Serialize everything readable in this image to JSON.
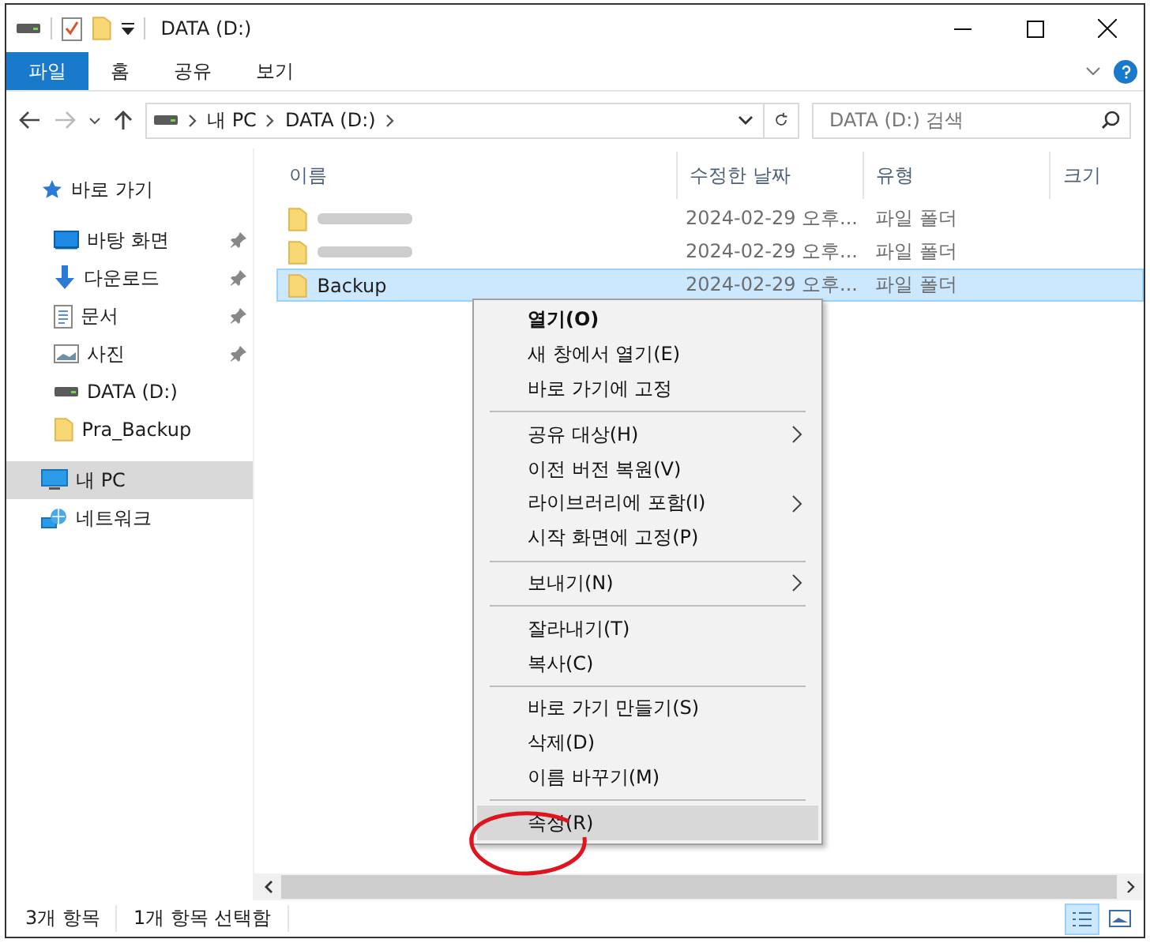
{
  "window": {
    "title": "DATA (D:)"
  },
  "ribbon_tabs": [
    {
      "label": "파일",
      "selected": true
    },
    {
      "label": "홈",
      "selected": false
    },
    {
      "label": "공유",
      "selected": false
    },
    {
      "label": "보기",
      "selected": false
    }
  ],
  "address": {
    "crumbs": [
      "내 PC",
      "DATA (D:)"
    ]
  },
  "search": {
    "placeholder": "DATA (D:) 검색"
  },
  "sidebar": {
    "items": [
      {
        "label": "바로 가기",
        "kind": "quick",
        "selected": false,
        "pinned": false,
        "children": [
          {
            "label": "바탕 화면",
            "kind": "desktop",
            "selected": false,
            "pinned": true
          },
          {
            "label": "다운로드",
            "kind": "download",
            "selected": false,
            "pinned": true
          },
          {
            "label": "문서",
            "kind": "document",
            "selected": false,
            "pinned": true
          },
          {
            "label": "사진",
            "kind": "pictures",
            "selected": false,
            "pinned": true
          },
          {
            "label": "DATA (D:)",
            "kind": "drive",
            "selected": false,
            "pinned": false
          },
          {
            "label": "Pra_Backup",
            "kind": "folder",
            "selected": false,
            "pinned": false
          }
        ]
      },
      {
        "label": "내 PC",
        "kind": "pc",
        "selected": true,
        "pinned": false
      },
      {
        "label": "네트워크",
        "kind": "network",
        "selected": false,
        "pinned": false
      }
    ]
  },
  "table": {
    "columns": [
      "이름",
      "수정한 날짜",
      "유형",
      "크기"
    ],
    "rows": [
      {
        "kind": "blurred",
        "modified": "2024-02-29 오후...",
        "type": "파일 폴더",
        "selected": false
      },
      {
        "kind": "blurred",
        "modified": "2024-02-29 오후...",
        "type": "파일 폴더",
        "selected": false
      },
      {
        "kind": "named",
        "name": "Backup",
        "modified": "2024-02-29 오후...",
        "type": "파일 폴더",
        "selected": true
      }
    ]
  },
  "context_menu": {
    "items": [
      {
        "kind": "item",
        "label": "열기(O)",
        "default": true,
        "submenu": false,
        "selected": false
      },
      {
        "kind": "item",
        "label": "새 창에서 열기(E)",
        "default": false,
        "submenu": false,
        "selected": false
      },
      {
        "kind": "item",
        "label": "바로 가기에 고정",
        "default": false,
        "submenu": false,
        "selected": false
      },
      {
        "kind": "separator"
      },
      {
        "kind": "item",
        "label": "공유 대상(H)",
        "default": false,
        "submenu": true,
        "selected": false
      },
      {
        "kind": "item",
        "label": "이전 버전 복원(V)",
        "default": false,
        "submenu": false,
        "selected": false
      },
      {
        "kind": "item",
        "label": "라이브러리에 포함(I)",
        "default": false,
        "submenu": true,
        "selected": false
      },
      {
        "kind": "item",
        "label": "시작 화면에 고정(P)",
        "default": false,
        "submenu": false,
        "selected": false
      },
      {
        "kind": "separator"
      },
      {
        "kind": "item",
        "label": "보내기(N)",
        "default": false,
        "submenu": true,
        "selected": false
      },
      {
        "kind": "separator"
      },
      {
        "kind": "item",
        "label": "잘라내기(T)",
        "default": false,
        "submenu": false,
        "selected": false
      },
      {
        "kind": "item",
        "label": "복사(C)",
        "default": false,
        "submenu": false,
        "selected": false
      },
      {
        "kind": "separator"
      },
      {
        "kind": "item",
        "label": "바로 가기 만들기(S)",
        "default": false,
        "submenu": false,
        "selected": false
      },
      {
        "kind": "item",
        "label": "삭제(D)",
        "default": false,
        "submenu": false,
        "selected": false
      },
      {
        "kind": "item",
        "label": "이름 바꾸기(M)",
        "default": false,
        "submenu": false,
        "selected": false
      },
      {
        "kind": "separator"
      },
      {
        "kind": "item",
        "label": "속성(R)",
        "default": false,
        "submenu": false,
        "selected": true,
        "circled": true
      }
    ]
  },
  "status_bar": {
    "texts": [
      "3개 항목",
      "1개 항목 선택함"
    ],
    "view_buttons": [
      {
        "kind": "details",
        "selected": true
      },
      {
        "kind": "thumbnails",
        "selected": false
      }
    ]
  }
}
